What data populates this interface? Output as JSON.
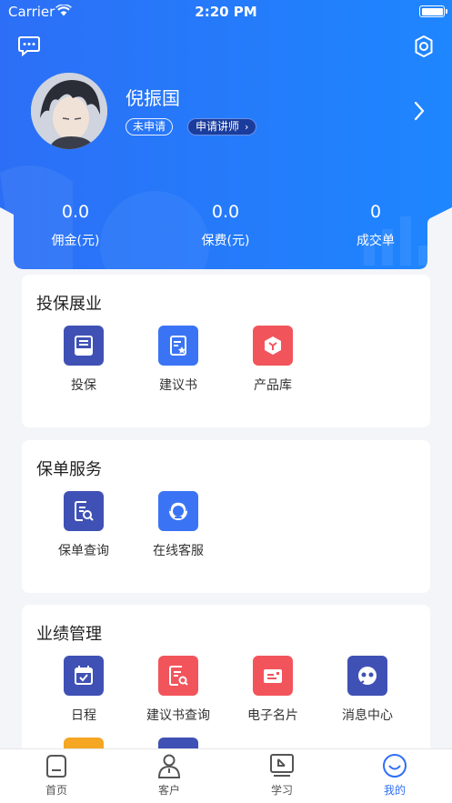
{
  "status_bar": {
    "carrier": "Carrier",
    "time": "2:20 PM"
  },
  "profile": {
    "name": "倪振国",
    "status_badge": "未申请",
    "apply_badge": "申请讲师"
  },
  "stats": [
    {
      "value": "0.0",
      "label": "佣金(元)"
    },
    {
      "value": "0.0",
      "label": "保费(元)"
    },
    {
      "value": "0",
      "label": "成交单"
    }
  ],
  "sections": [
    {
      "title": "投保展业",
      "items": [
        {
          "label": "投保",
          "icon": "insure-icon",
          "color": "#3f51b5"
        },
        {
          "label": "建议书",
          "icon": "proposal-icon",
          "color": "#3a74f5"
        },
        {
          "label": "产品库",
          "icon": "product-library-icon",
          "color": "#f2545b"
        }
      ]
    },
    {
      "title": "保单服务",
      "items": [
        {
          "label": "保单查询",
          "icon": "policy-search-icon",
          "color": "#3f51b5"
        },
        {
          "label": "在线客服",
          "icon": "customer-service-icon",
          "color": "#3a74f5"
        }
      ]
    },
    {
      "title": "业绩管理",
      "items": [
        {
          "label": "日程",
          "icon": "calendar-icon",
          "color": "#3f51b5"
        },
        {
          "label": "建议书查询",
          "icon": "proposal-search-icon",
          "color": "#f2545b"
        },
        {
          "label": "电子名片",
          "icon": "business-card-icon",
          "color": "#f2545b"
        },
        {
          "label": "消息中心",
          "icon": "message-center-icon",
          "color": "#3f51b5"
        }
      ]
    }
  ],
  "tabs": [
    {
      "label": "首页",
      "icon": "home-icon",
      "active": false
    },
    {
      "label": "客户",
      "icon": "customer-icon",
      "active": false
    },
    {
      "label": "学习",
      "icon": "study-icon",
      "active": false
    },
    {
      "label": "我的",
      "icon": "mine-icon",
      "active": true
    }
  ],
  "colors": {
    "brand_blue": "#2f6ff6",
    "active_tab": "#2f6ff6",
    "red": "#f2545b",
    "indigo": "#3f51b5",
    "orange": "#f5a623"
  }
}
